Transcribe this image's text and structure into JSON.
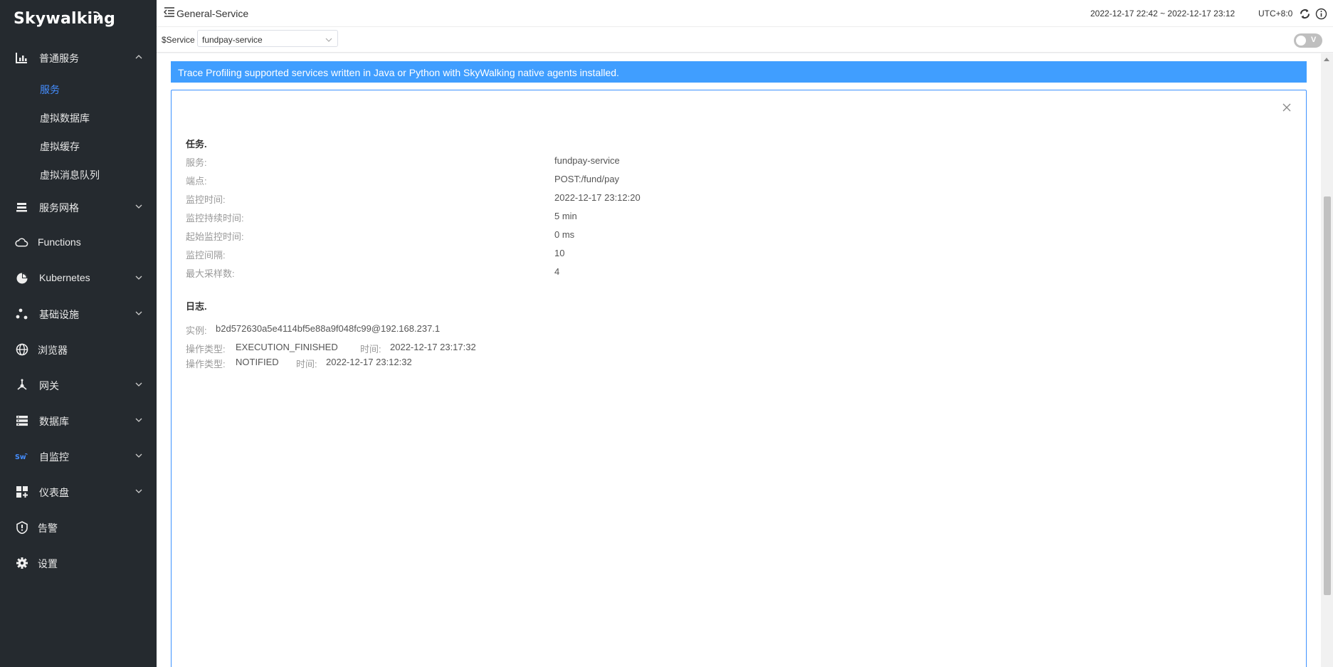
{
  "brand": {
    "logo_text": "Skywalking"
  },
  "sidebar": {
    "items": [
      {
        "label": "普通服务",
        "icon": "chart-bar-icon",
        "expanded": true
      },
      {
        "label": "服务网格",
        "icon": "stack-icon"
      },
      {
        "label": "Functions",
        "icon": "cloud-icon"
      },
      {
        "label": "Kubernetes",
        "icon": "pie-icon"
      },
      {
        "label": "基础设施",
        "icon": "nodes-icon"
      },
      {
        "label": "浏览器",
        "icon": "globe-icon"
      },
      {
        "label": "网关",
        "icon": "gateway-icon"
      },
      {
        "label": "数据库",
        "icon": "database-icon"
      },
      {
        "label": "自监控",
        "icon": "sw-logo-icon"
      },
      {
        "label": "仪表盘",
        "icon": "dashboard-icon"
      },
      {
        "label": "告警",
        "icon": "alert-icon"
      },
      {
        "label": "设置",
        "icon": "gear-icon"
      }
    ],
    "sub_items": [
      {
        "label": "服务",
        "active": true
      },
      {
        "label": "虚拟数据库"
      },
      {
        "label": "虚拟缓存"
      },
      {
        "label": "虚拟消息队列"
      }
    ]
  },
  "header": {
    "title": "General-Service",
    "time_range": "2022-12-17 22:42 ~ 2022-12-17 23:12",
    "timezone": "UTC+8:0"
  },
  "selector": {
    "label": "$Service",
    "value": "fundpay-service",
    "switch_label": "V"
  },
  "banner": {
    "text": "Trace Profiling supported services written in Java or Python with SkyWalking native agents installed."
  },
  "task": {
    "title": "任务.",
    "rows": [
      {
        "key": "服务:",
        "value": "fundpay-service"
      },
      {
        "key": "端点:",
        "value": "POST:/fund/pay"
      },
      {
        "key": "监控时间:",
        "value": "2022-12-17 23:12:20"
      },
      {
        "key": "监控持续时间:",
        "value": "5 min"
      },
      {
        "key": "起始监控时间:",
        "value": "0 ms"
      },
      {
        "key": "监控间隔:",
        "value": "10"
      },
      {
        "key": "最大采样数:",
        "value": "4"
      }
    ]
  },
  "logs": {
    "title": "日志.",
    "instance_label": "实例:",
    "instance": "b2d572630a5e4114bf5e88a9f048fc99@192.168.237.1",
    "op_label": "操作类型:",
    "time_label": "时间:",
    "entries": [
      {
        "op": "EXECUTION_FINISHED",
        "time": "2022-12-17 23:17:32"
      },
      {
        "op": "NOTIFIED",
        "time": "2022-12-17 23:12:32"
      }
    ]
  },
  "colors": {
    "sidebar_bg": "#252a2f",
    "accent": "#409eff",
    "active_link": "#448dfe"
  }
}
